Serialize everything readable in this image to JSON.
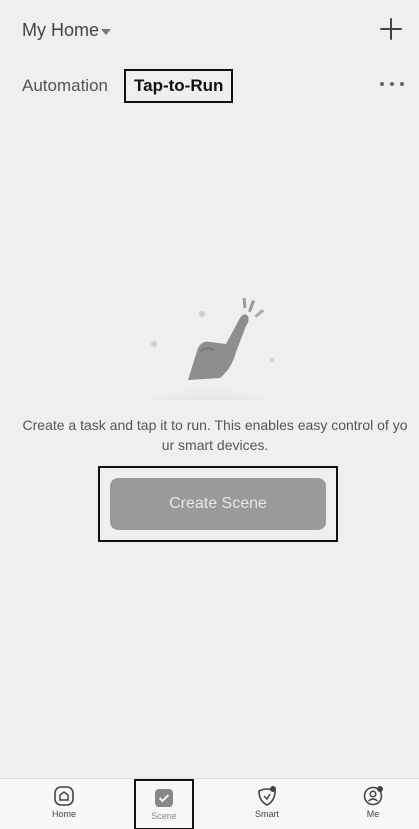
{
  "header": {
    "home_name": "My Home",
    "tabs": [
      {
        "label": "Automation",
        "active": false
      },
      {
        "label": "Tap-to-Run",
        "active": true
      }
    ]
  },
  "empty_state": {
    "message": "Create a task and tap it to run. This enables easy control of your smart devices.",
    "button_label": "Create Scene"
  },
  "bottom_nav": {
    "items": [
      {
        "label": "Home",
        "icon": "house-icon"
      },
      {
        "label": "Scene",
        "icon": "scene-checkbox-icon",
        "active": true
      },
      {
        "label": "Smart",
        "icon": "smart-shield-icon"
      },
      {
        "label": "Me",
        "icon": "profile-icon"
      }
    ]
  },
  "colors": {
    "background": "#efefef",
    "button": "#9a9a9a",
    "button_text": "#e8e8e8",
    "text_primary": "#333333"
  }
}
